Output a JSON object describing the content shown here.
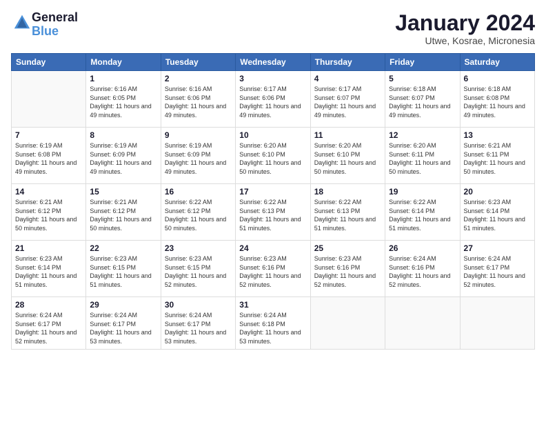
{
  "logo": {
    "line1": "General",
    "line2": "Blue"
  },
  "title": "January 2024",
  "location": "Utwe, Kosrae, Micronesia",
  "days_of_week": [
    "Sunday",
    "Monday",
    "Tuesday",
    "Wednesday",
    "Thursday",
    "Friday",
    "Saturday"
  ],
  "weeks": [
    [
      {
        "day": "",
        "sunrise": "",
        "sunset": "",
        "daylight": ""
      },
      {
        "day": "1",
        "sunrise": "Sunrise: 6:16 AM",
        "sunset": "Sunset: 6:05 PM",
        "daylight": "Daylight: 11 hours and 49 minutes."
      },
      {
        "day": "2",
        "sunrise": "Sunrise: 6:16 AM",
        "sunset": "Sunset: 6:06 PM",
        "daylight": "Daylight: 11 hours and 49 minutes."
      },
      {
        "day": "3",
        "sunrise": "Sunrise: 6:17 AM",
        "sunset": "Sunset: 6:06 PM",
        "daylight": "Daylight: 11 hours and 49 minutes."
      },
      {
        "day": "4",
        "sunrise": "Sunrise: 6:17 AM",
        "sunset": "Sunset: 6:07 PM",
        "daylight": "Daylight: 11 hours and 49 minutes."
      },
      {
        "day": "5",
        "sunrise": "Sunrise: 6:18 AM",
        "sunset": "Sunset: 6:07 PM",
        "daylight": "Daylight: 11 hours and 49 minutes."
      },
      {
        "day": "6",
        "sunrise": "Sunrise: 6:18 AM",
        "sunset": "Sunset: 6:08 PM",
        "daylight": "Daylight: 11 hours and 49 minutes."
      }
    ],
    [
      {
        "day": "7",
        "sunrise": "Sunrise: 6:19 AM",
        "sunset": "Sunset: 6:08 PM",
        "daylight": "Daylight: 11 hours and 49 minutes."
      },
      {
        "day": "8",
        "sunrise": "Sunrise: 6:19 AM",
        "sunset": "Sunset: 6:09 PM",
        "daylight": "Daylight: 11 hours and 49 minutes."
      },
      {
        "day": "9",
        "sunrise": "Sunrise: 6:19 AM",
        "sunset": "Sunset: 6:09 PM",
        "daylight": "Daylight: 11 hours and 49 minutes."
      },
      {
        "day": "10",
        "sunrise": "Sunrise: 6:20 AM",
        "sunset": "Sunset: 6:10 PM",
        "daylight": "Daylight: 11 hours and 50 minutes."
      },
      {
        "day": "11",
        "sunrise": "Sunrise: 6:20 AM",
        "sunset": "Sunset: 6:10 PM",
        "daylight": "Daylight: 11 hours and 50 minutes."
      },
      {
        "day": "12",
        "sunrise": "Sunrise: 6:20 AM",
        "sunset": "Sunset: 6:11 PM",
        "daylight": "Daylight: 11 hours and 50 minutes."
      },
      {
        "day": "13",
        "sunrise": "Sunrise: 6:21 AM",
        "sunset": "Sunset: 6:11 PM",
        "daylight": "Daylight: 11 hours and 50 minutes."
      }
    ],
    [
      {
        "day": "14",
        "sunrise": "Sunrise: 6:21 AM",
        "sunset": "Sunset: 6:12 PM",
        "daylight": "Daylight: 11 hours and 50 minutes."
      },
      {
        "day": "15",
        "sunrise": "Sunrise: 6:21 AM",
        "sunset": "Sunset: 6:12 PM",
        "daylight": "Daylight: 11 hours and 50 minutes."
      },
      {
        "day": "16",
        "sunrise": "Sunrise: 6:22 AM",
        "sunset": "Sunset: 6:12 PM",
        "daylight": "Daylight: 11 hours and 50 minutes."
      },
      {
        "day": "17",
        "sunrise": "Sunrise: 6:22 AM",
        "sunset": "Sunset: 6:13 PM",
        "daylight": "Daylight: 11 hours and 51 minutes."
      },
      {
        "day": "18",
        "sunrise": "Sunrise: 6:22 AM",
        "sunset": "Sunset: 6:13 PM",
        "daylight": "Daylight: 11 hours and 51 minutes."
      },
      {
        "day": "19",
        "sunrise": "Sunrise: 6:22 AM",
        "sunset": "Sunset: 6:14 PM",
        "daylight": "Daylight: 11 hours and 51 minutes."
      },
      {
        "day": "20",
        "sunrise": "Sunrise: 6:23 AM",
        "sunset": "Sunset: 6:14 PM",
        "daylight": "Daylight: 11 hours and 51 minutes."
      }
    ],
    [
      {
        "day": "21",
        "sunrise": "Sunrise: 6:23 AM",
        "sunset": "Sunset: 6:14 PM",
        "daylight": "Daylight: 11 hours and 51 minutes."
      },
      {
        "day": "22",
        "sunrise": "Sunrise: 6:23 AM",
        "sunset": "Sunset: 6:15 PM",
        "daylight": "Daylight: 11 hours and 51 minutes."
      },
      {
        "day": "23",
        "sunrise": "Sunrise: 6:23 AM",
        "sunset": "Sunset: 6:15 PM",
        "daylight": "Daylight: 11 hours and 52 minutes."
      },
      {
        "day": "24",
        "sunrise": "Sunrise: 6:23 AM",
        "sunset": "Sunset: 6:16 PM",
        "daylight": "Daylight: 11 hours and 52 minutes."
      },
      {
        "day": "25",
        "sunrise": "Sunrise: 6:23 AM",
        "sunset": "Sunset: 6:16 PM",
        "daylight": "Daylight: 11 hours and 52 minutes."
      },
      {
        "day": "26",
        "sunrise": "Sunrise: 6:24 AM",
        "sunset": "Sunset: 6:16 PM",
        "daylight": "Daylight: 11 hours and 52 minutes."
      },
      {
        "day": "27",
        "sunrise": "Sunrise: 6:24 AM",
        "sunset": "Sunset: 6:17 PM",
        "daylight": "Daylight: 11 hours and 52 minutes."
      }
    ],
    [
      {
        "day": "28",
        "sunrise": "Sunrise: 6:24 AM",
        "sunset": "Sunset: 6:17 PM",
        "daylight": "Daylight: 11 hours and 52 minutes."
      },
      {
        "day": "29",
        "sunrise": "Sunrise: 6:24 AM",
        "sunset": "Sunset: 6:17 PM",
        "daylight": "Daylight: 11 hours and 53 minutes."
      },
      {
        "day": "30",
        "sunrise": "Sunrise: 6:24 AM",
        "sunset": "Sunset: 6:17 PM",
        "daylight": "Daylight: 11 hours and 53 minutes."
      },
      {
        "day": "31",
        "sunrise": "Sunrise: 6:24 AM",
        "sunset": "Sunset: 6:18 PM",
        "daylight": "Daylight: 11 hours and 53 minutes."
      },
      {
        "day": "",
        "sunrise": "",
        "sunset": "",
        "daylight": ""
      },
      {
        "day": "",
        "sunrise": "",
        "sunset": "",
        "daylight": ""
      },
      {
        "day": "",
        "sunrise": "",
        "sunset": "",
        "daylight": ""
      }
    ]
  ]
}
